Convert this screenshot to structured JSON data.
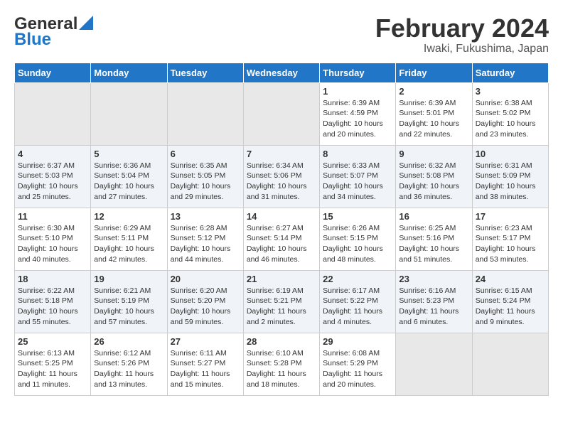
{
  "header": {
    "logo_general": "General",
    "logo_blue": "Blue",
    "month_title": "February 2024",
    "location": "Iwaki, Fukushima, Japan"
  },
  "days_of_week": [
    "Sunday",
    "Monday",
    "Tuesday",
    "Wednesday",
    "Thursday",
    "Friday",
    "Saturday"
  ],
  "weeks": [
    [
      {
        "day": "",
        "info": ""
      },
      {
        "day": "",
        "info": ""
      },
      {
        "day": "",
        "info": ""
      },
      {
        "day": "",
        "info": ""
      },
      {
        "day": "1",
        "info": "Sunrise: 6:39 AM\nSunset: 4:59 PM\nDaylight: 10 hours\nand 20 minutes."
      },
      {
        "day": "2",
        "info": "Sunrise: 6:39 AM\nSunset: 5:01 PM\nDaylight: 10 hours\nand 22 minutes."
      },
      {
        "day": "3",
        "info": "Sunrise: 6:38 AM\nSunset: 5:02 PM\nDaylight: 10 hours\nand 23 minutes."
      }
    ],
    [
      {
        "day": "4",
        "info": "Sunrise: 6:37 AM\nSunset: 5:03 PM\nDaylight: 10 hours\nand 25 minutes."
      },
      {
        "day": "5",
        "info": "Sunrise: 6:36 AM\nSunset: 5:04 PM\nDaylight: 10 hours\nand 27 minutes."
      },
      {
        "day": "6",
        "info": "Sunrise: 6:35 AM\nSunset: 5:05 PM\nDaylight: 10 hours\nand 29 minutes."
      },
      {
        "day": "7",
        "info": "Sunrise: 6:34 AM\nSunset: 5:06 PM\nDaylight: 10 hours\nand 31 minutes."
      },
      {
        "day": "8",
        "info": "Sunrise: 6:33 AM\nSunset: 5:07 PM\nDaylight: 10 hours\nand 34 minutes."
      },
      {
        "day": "9",
        "info": "Sunrise: 6:32 AM\nSunset: 5:08 PM\nDaylight: 10 hours\nand 36 minutes."
      },
      {
        "day": "10",
        "info": "Sunrise: 6:31 AM\nSunset: 5:09 PM\nDaylight: 10 hours\nand 38 minutes."
      }
    ],
    [
      {
        "day": "11",
        "info": "Sunrise: 6:30 AM\nSunset: 5:10 PM\nDaylight: 10 hours\nand 40 minutes."
      },
      {
        "day": "12",
        "info": "Sunrise: 6:29 AM\nSunset: 5:11 PM\nDaylight: 10 hours\nand 42 minutes."
      },
      {
        "day": "13",
        "info": "Sunrise: 6:28 AM\nSunset: 5:12 PM\nDaylight: 10 hours\nand 44 minutes."
      },
      {
        "day": "14",
        "info": "Sunrise: 6:27 AM\nSunset: 5:14 PM\nDaylight: 10 hours\nand 46 minutes."
      },
      {
        "day": "15",
        "info": "Sunrise: 6:26 AM\nSunset: 5:15 PM\nDaylight: 10 hours\nand 48 minutes."
      },
      {
        "day": "16",
        "info": "Sunrise: 6:25 AM\nSunset: 5:16 PM\nDaylight: 10 hours\nand 51 minutes."
      },
      {
        "day": "17",
        "info": "Sunrise: 6:23 AM\nSunset: 5:17 PM\nDaylight: 10 hours\nand 53 minutes."
      }
    ],
    [
      {
        "day": "18",
        "info": "Sunrise: 6:22 AM\nSunset: 5:18 PM\nDaylight: 10 hours\nand 55 minutes."
      },
      {
        "day": "19",
        "info": "Sunrise: 6:21 AM\nSunset: 5:19 PM\nDaylight: 10 hours\nand 57 minutes."
      },
      {
        "day": "20",
        "info": "Sunrise: 6:20 AM\nSunset: 5:20 PM\nDaylight: 10 hours\nand 59 minutes."
      },
      {
        "day": "21",
        "info": "Sunrise: 6:19 AM\nSunset: 5:21 PM\nDaylight: 11 hours\nand 2 minutes."
      },
      {
        "day": "22",
        "info": "Sunrise: 6:17 AM\nSunset: 5:22 PM\nDaylight: 11 hours\nand 4 minutes."
      },
      {
        "day": "23",
        "info": "Sunrise: 6:16 AM\nSunset: 5:23 PM\nDaylight: 11 hours\nand 6 minutes."
      },
      {
        "day": "24",
        "info": "Sunrise: 6:15 AM\nSunset: 5:24 PM\nDaylight: 11 hours\nand 9 minutes."
      }
    ],
    [
      {
        "day": "25",
        "info": "Sunrise: 6:13 AM\nSunset: 5:25 PM\nDaylight: 11 hours\nand 11 minutes."
      },
      {
        "day": "26",
        "info": "Sunrise: 6:12 AM\nSunset: 5:26 PM\nDaylight: 11 hours\nand 13 minutes."
      },
      {
        "day": "27",
        "info": "Sunrise: 6:11 AM\nSunset: 5:27 PM\nDaylight: 11 hours\nand 15 minutes."
      },
      {
        "day": "28",
        "info": "Sunrise: 6:10 AM\nSunset: 5:28 PM\nDaylight: 11 hours\nand 18 minutes."
      },
      {
        "day": "29",
        "info": "Sunrise: 6:08 AM\nSunset: 5:29 PM\nDaylight: 11 hours\nand 20 minutes."
      },
      {
        "day": "",
        "info": ""
      },
      {
        "day": "",
        "info": ""
      }
    ]
  ]
}
